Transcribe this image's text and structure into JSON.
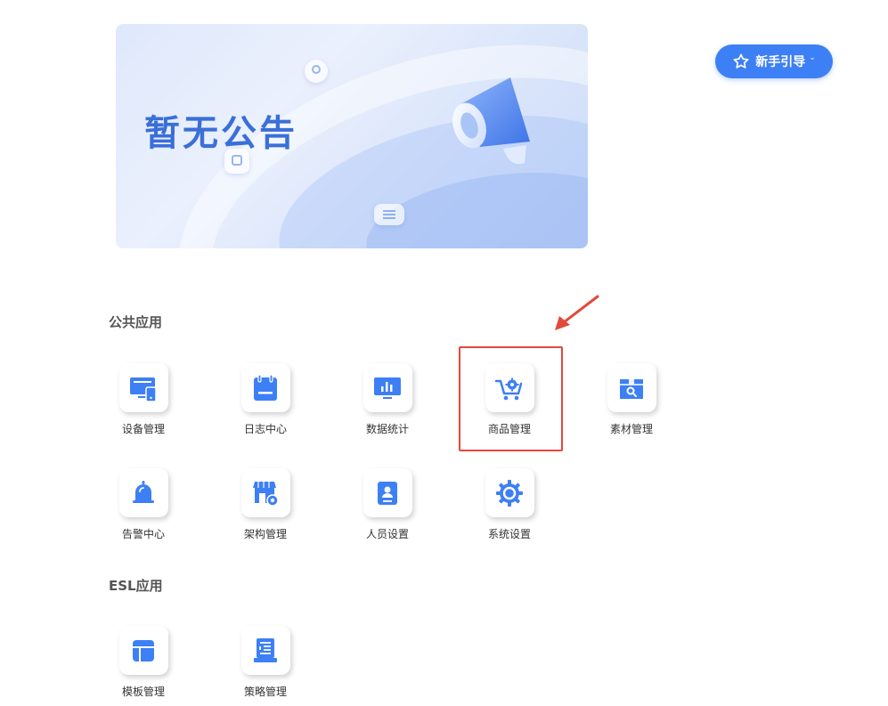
{
  "banner": {
    "title": "暂无公告"
  },
  "guide_button": {
    "label": "新手引导"
  },
  "sections": [
    {
      "title": "公共应用",
      "apps": [
        {
          "label": "设备管理",
          "icon": "device-monitor-icon"
        },
        {
          "label": "日志中心",
          "icon": "calendar-log-icon"
        },
        {
          "label": "数据统计",
          "icon": "statistics-chart-icon"
        },
        {
          "label": "商品管理",
          "icon": "shopping-cart-icon"
        },
        {
          "label": "素材管理",
          "icon": "material-box-search-icon"
        },
        {
          "label": "告警中心",
          "icon": "alarm-bell-icon"
        },
        {
          "label": "架构管理",
          "icon": "store-settings-icon"
        },
        {
          "label": "人员设置",
          "icon": "person-card-icon"
        },
        {
          "label": "系统设置",
          "icon": "gear-icon"
        }
      ]
    },
    {
      "title": "ESL应用",
      "apps": [
        {
          "label": "模板管理",
          "icon": "template-layout-icon"
        },
        {
          "label": "策略管理",
          "icon": "strategy-list-icon"
        }
      ]
    }
  ],
  "colors": {
    "accent": "#3d7ff5",
    "icon_blue": "#3d7ff5",
    "highlight": "#e24a3b"
  }
}
